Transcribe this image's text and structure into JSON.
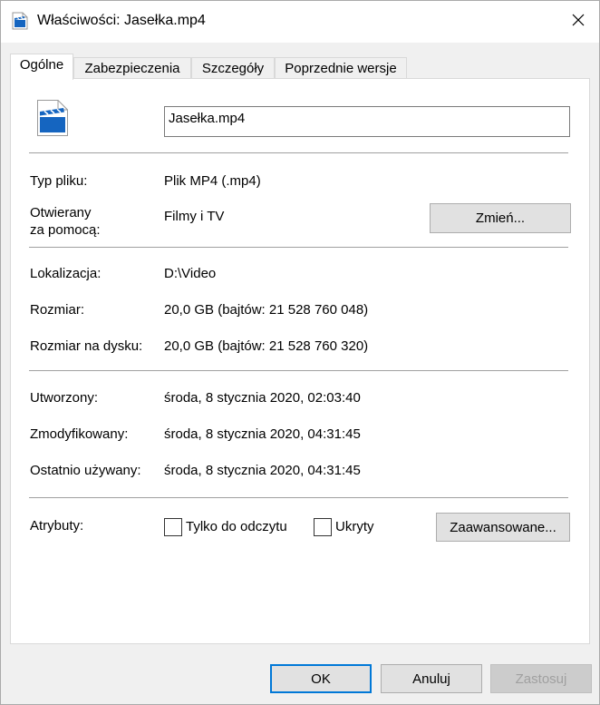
{
  "window": {
    "title": "Właściwości: Jasełka.mp4",
    "icon": "video-file-icon",
    "close_icon": "close-icon"
  },
  "tabs": [
    {
      "label": "Ogólne",
      "active": true
    },
    {
      "label": "Zabezpieczenia",
      "active": false
    },
    {
      "label": "Szczegóły",
      "active": false
    },
    {
      "label": "Poprzednie wersje",
      "active": false
    }
  ],
  "general": {
    "file_name": "Jasełka.mp4",
    "file_type_label": "Typ pliku:",
    "file_type_value": "Plik MP4 (.mp4)",
    "opens_with_label_1": "Otwierany",
    "opens_with_label_2": "za pomocą:",
    "opens_with_value": "Filmy i TV",
    "change_button": "Zmień...",
    "location_label": "Lokalizacja:",
    "location_value": "D:\\Video",
    "size_label": "Rozmiar:",
    "size_value": "20,0 GB (bajtów: 21 528 760 048)",
    "size_on_disk_label": "Rozmiar na dysku:",
    "size_on_disk_value": "20,0 GB (bajtów: 21 528 760 320)",
    "created_label": "Utworzony:",
    "created_value": "środa, 8 stycznia 2020, 02:03:40",
    "modified_label": "Zmodyfikowany:",
    "modified_value": "środa, 8 stycznia 2020, 04:31:45",
    "accessed_label": "Ostatnio używany:",
    "accessed_value": "środa, 8 stycznia 2020, 04:31:45",
    "attributes_label": "Atrybuty:",
    "readonly_label": "Tylko do odczytu",
    "readonly_checked": false,
    "hidden_label": "Ukryty",
    "hidden_checked": false,
    "advanced_button": "Zaawansowane..."
  },
  "footer": {
    "ok": "OK",
    "cancel": "Anuluj",
    "apply": "Zastosuj"
  },
  "colors": {
    "accent": "#0078d7",
    "icon_blue": "#1565c0"
  }
}
